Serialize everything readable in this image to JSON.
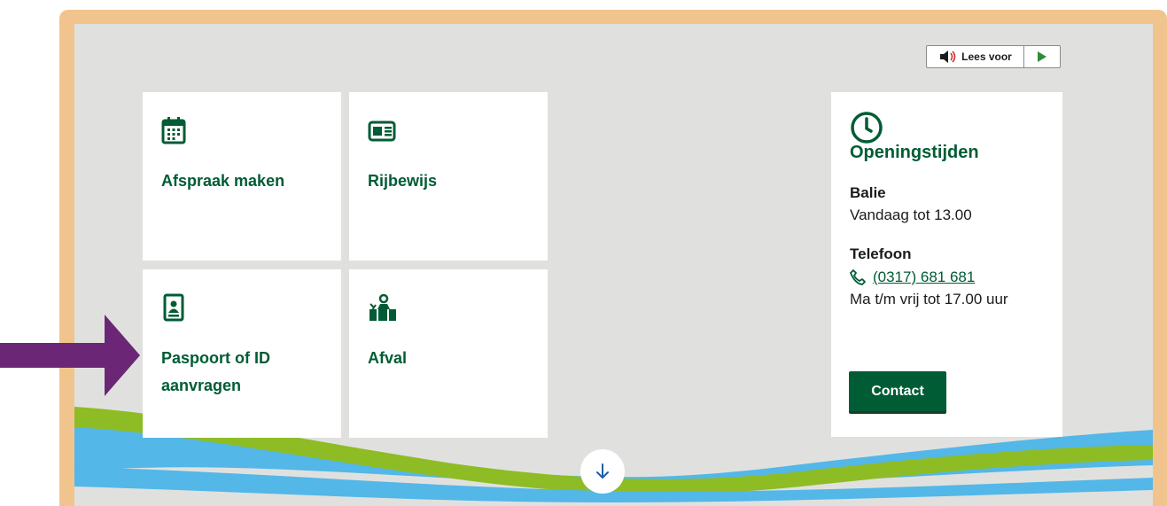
{
  "toolbar": {
    "read_aloud_label": "Lees voor",
    "read_aloud_icon": "speaker-icon",
    "play_icon": "play-icon"
  },
  "tiles": [
    {
      "label": "Afspraak maken",
      "icon": "calendar-icon"
    },
    {
      "label": "Rijbewijs",
      "icon": "id-card-icon"
    },
    {
      "label": "Paspoort of ID aanvragen",
      "icon": "passport-icon"
    },
    {
      "label": "Afval",
      "icon": "waste-bins-icon"
    }
  ],
  "opening_hours": {
    "icon": "clock-icon",
    "title": "Openingstijden",
    "counter_heading": "Balie",
    "counter_text": "Vandaag tot 13.00",
    "phone_heading": "Telefoon",
    "phone_number": "(0317) 681 681",
    "phone_hours": "Ma t/m vrij tot 17.00 uur",
    "contact_button": "Contact"
  },
  "scroll_down_icon": "arrow-down-icon",
  "colors": {
    "brand_green": "#005c34",
    "frame": "#f2c48d",
    "panel": "#e0e1df",
    "wave_green": "#8ebc24",
    "wave_blue": "#53b7e8",
    "arrow": "#6b2775"
  }
}
